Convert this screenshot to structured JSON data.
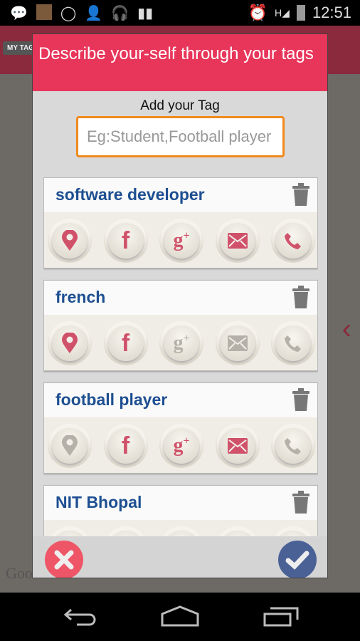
{
  "status_bar": {
    "time": "12:51",
    "icons": [
      "bbm-icon",
      "game-icon",
      "whatsapp-icon",
      "add-contact-icon",
      "headphones-icon",
      "barcode-icon",
      "alarm-icon",
      "signal-icon",
      "battery-icon"
    ],
    "network": "H"
  },
  "background": {
    "tag_logo": "MY TAGS",
    "map_watermark": "Google"
  },
  "dialog": {
    "title": "Describe your-self through your tags",
    "add_label": "Add your Tag",
    "input": {
      "value": "",
      "placeholder": "Eg:Student,Football player"
    },
    "colors": {
      "accent": "#e8355a",
      "tag_text": "#1d4f91",
      "active_icon": "#d0526a",
      "inactive_icon": "#b5b0a8"
    },
    "tags": [
      {
        "name": "software developer",
        "services": {
          "location": true,
          "facebook": true,
          "google_plus": true,
          "email": true,
          "phone": true
        }
      },
      {
        "name": "french",
        "services": {
          "location": true,
          "facebook": true,
          "google_plus": false,
          "email": false,
          "phone": false
        }
      },
      {
        "name": "football player",
        "services": {
          "location": false,
          "facebook": true,
          "google_plus": true,
          "email": true,
          "phone": false
        }
      },
      {
        "name": "NIT Bhopal",
        "services": {}
      }
    ],
    "cancel_icon": "close-icon",
    "confirm_icon": "check-icon"
  },
  "nav": {
    "icons": [
      "back-icon",
      "home-icon",
      "recents-icon"
    ]
  }
}
